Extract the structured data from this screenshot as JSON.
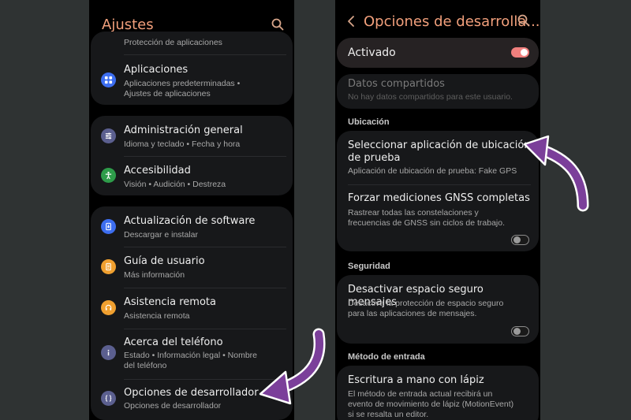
{
  "left": {
    "title": "Ajustes",
    "partial_top_text": "Protección de aplicaciones",
    "groups": [
      [
        {
          "title": "Aplicaciones",
          "subtitle": [
            "Aplicaciones predeterminadas  •",
            "Ajustes de aplicaciones"
          ],
          "icon": "apps-grid-icon",
          "color": "#3d6ef0"
        }
      ],
      [
        {
          "title": "Administración general",
          "subtitle": [
            "Idioma y teclado  •  Fecha y hora"
          ],
          "icon": "sliders-icon",
          "color": "#5b5f8f"
        },
        {
          "title": "Accesibilidad",
          "subtitle": [
            "Visión  •  Audición  •  Destreza"
          ],
          "icon": "accessibility-icon",
          "color": "#2e9c4a"
        }
      ],
      [
        {
          "title": "Actualización de software",
          "subtitle": [
            "Descargar e instalar"
          ],
          "icon": "software-update-icon",
          "color": "#3d6ef0"
        },
        {
          "title": "Guía de usuario",
          "subtitle": [
            "Más información"
          ],
          "icon": "user-guide-icon",
          "color": "#f0a030"
        },
        {
          "title": "Asistencia remota",
          "subtitle": [
            "Asistencia remota"
          ],
          "icon": "headset-icon",
          "color": "#f0a030"
        },
        {
          "title": "Acerca del teléfono",
          "subtitle": [
            "Estado  •  Información legal  •  Nombre",
            "del teléfono"
          ],
          "icon": "info-icon",
          "color": "#5b5f8f"
        },
        {
          "title": "Opciones de desarrollador",
          "subtitle": [
            "Opciones de desarrollador"
          ],
          "icon": "developer-braces-icon",
          "color": "#5b5f8f"
        }
      ]
    ]
  },
  "right": {
    "title": "Opciones de desarrolla...",
    "activated_label": "Activado",
    "shared_data": {
      "title": "Datos compartidos",
      "subtitle": "No hay datos compartidos para este usuario."
    },
    "sections": {
      "location": "Ubicación",
      "security": "Seguridad",
      "input": "Método de entrada"
    },
    "mock_location": {
      "title": [
        "Seleccionar aplicación de ubicación",
        "de prueba"
      ],
      "subtitle": "Aplicación de ubicación de prueba: Fake GPS"
    },
    "gnss": {
      "title": "Forzar mediciones GNSS completas",
      "subtitle": [
        "Rastrear todas las constelaciones y",
        "frecuencias de GNSS sin ciclos de trabajo."
      ]
    },
    "secure_space": {
      "title": "Desactivar espacio seguro mensajes",
      "subtitle": [
        "Desactiva la protección de espacio seguro",
        "para las aplicaciones de mensajes."
      ]
    },
    "stylus": {
      "title": "Escritura a mano con lápiz",
      "subtitle": [
        "El método de entrada actual recibirá un",
        "evento de movimiento de lápiz (MotionEvent)",
        "si se resalta un editor."
      ]
    }
  },
  "colors": {
    "accent": "#f2a07c",
    "toggle_on": "#f0807e",
    "arrow": "#7b3f9a"
  }
}
